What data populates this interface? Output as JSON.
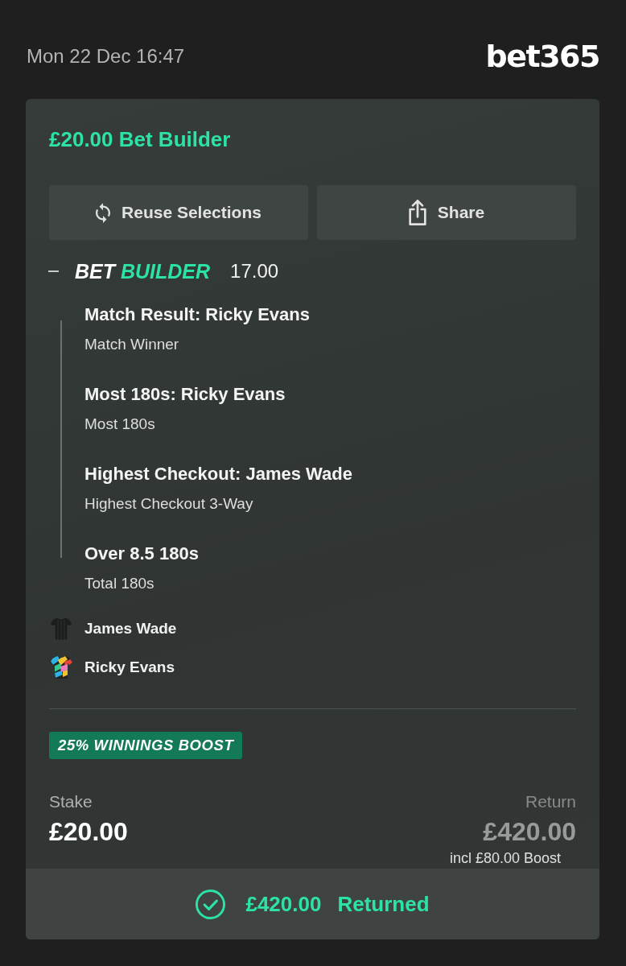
{
  "header": {
    "datetime": "Mon 22 Dec 16:47",
    "logo": "bet365"
  },
  "bet": {
    "title": "£20.00 Bet Builder",
    "actions": [
      {
        "label": "Reuse Selections",
        "kind": "reuse"
      },
      {
        "label": "Share",
        "kind": "share"
      }
    ],
    "builder": {
      "expanded": true,
      "label_words": [
        {
          "text": "BET",
          "accent": false
        },
        {
          "text": "BUILDER",
          "accent": true
        }
      ],
      "odds": "17.00"
    },
    "selections": [
      {
        "title": "Match Result: Ricky Evans",
        "market": "Match Winner"
      },
      {
        "title": "Most 180s: Ricky Evans",
        "market": "Most 180s"
      },
      {
        "title": "Highest Checkout: James Wade",
        "market": "Highest Checkout 3-Way"
      },
      {
        "title": "Over 8.5 180s",
        "market": "Total 180s"
      }
    ],
    "participants": [
      {
        "name": "James Wade",
        "kind": "plain"
      },
      {
        "name": "Ricky Evans",
        "kind": "patterned"
      }
    ],
    "boost_badge": "25% WINNINGS BOOST",
    "stake": {
      "label": "Stake",
      "value": "£20.00"
    },
    "return": {
      "label": "Return",
      "value": "£420.00",
      "note": "incl £80.00 Boost"
    },
    "result": {
      "kind": "returned",
      "amount": "£420.00",
      "label": "Returned"
    }
  }
}
